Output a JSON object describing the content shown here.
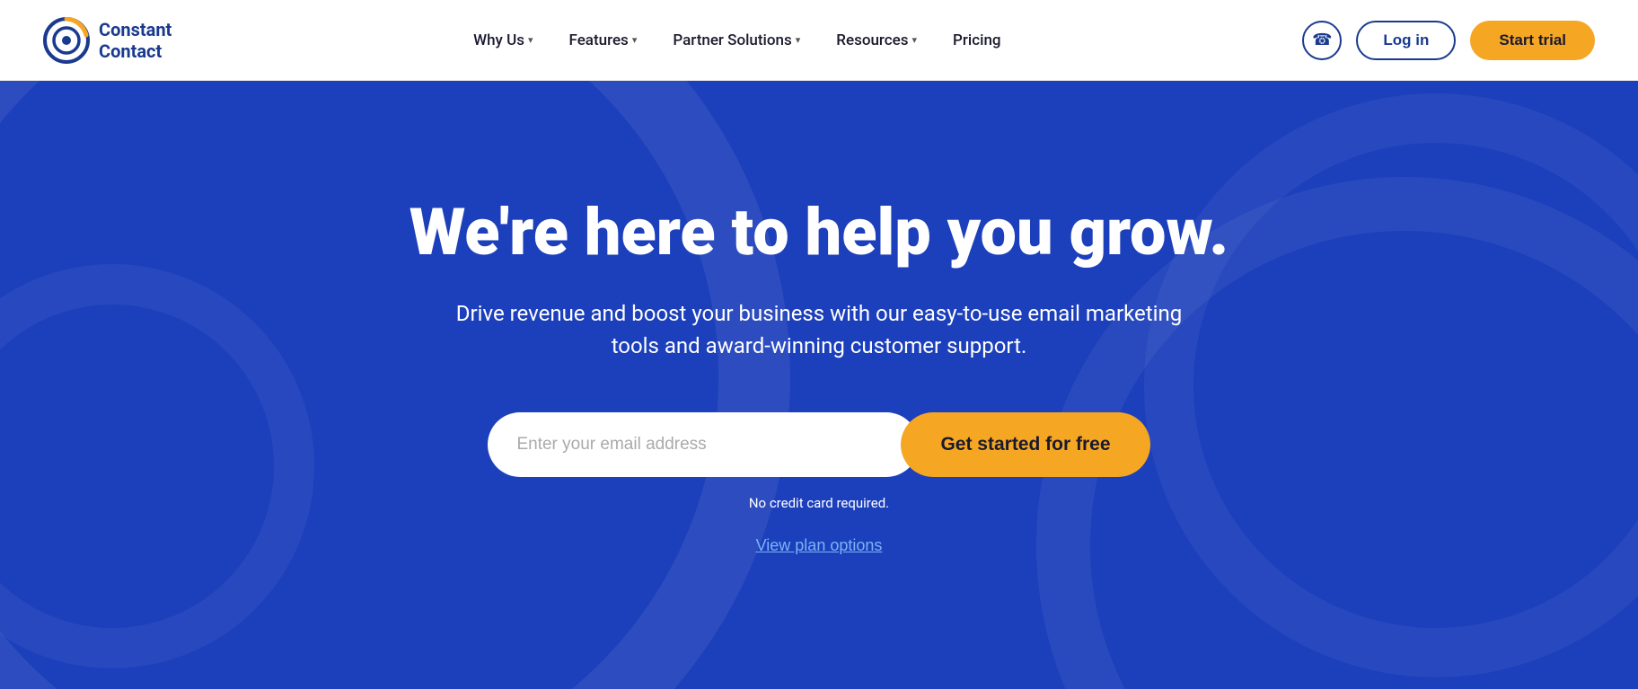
{
  "navbar": {
    "logo_line1": "Constant",
    "logo_line2": "Contact",
    "nav_items": [
      {
        "label": "Why Us",
        "has_dropdown": true
      },
      {
        "label": "Features",
        "has_dropdown": true
      },
      {
        "label": "Partner Solutions",
        "has_dropdown": true
      },
      {
        "label": "Resources",
        "has_dropdown": true
      },
      {
        "label": "Pricing",
        "has_dropdown": false
      }
    ],
    "phone_icon": "☎",
    "login_label": "Log in",
    "start_trial_label": "Start trial"
  },
  "hero": {
    "title": "We're here to help you grow.",
    "subtitle": "Drive revenue and boost your business with our easy-to-use email marketing tools and award-winning customer support.",
    "email_placeholder": "Enter your email address",
    "cta_label": "Get started for free",
    "no_credit_text": "No credit card required.",
    "view_plans_label": "View plan options"
  },
  "colors": {
    "brand_blue": "#1c3fbb",
    "brand_orange": "#f5a623",
    "logo_blue": "#1a3a8f",
    "white": "#ffffff",
    "link_blue": "#7ab4f5"
  }
}
